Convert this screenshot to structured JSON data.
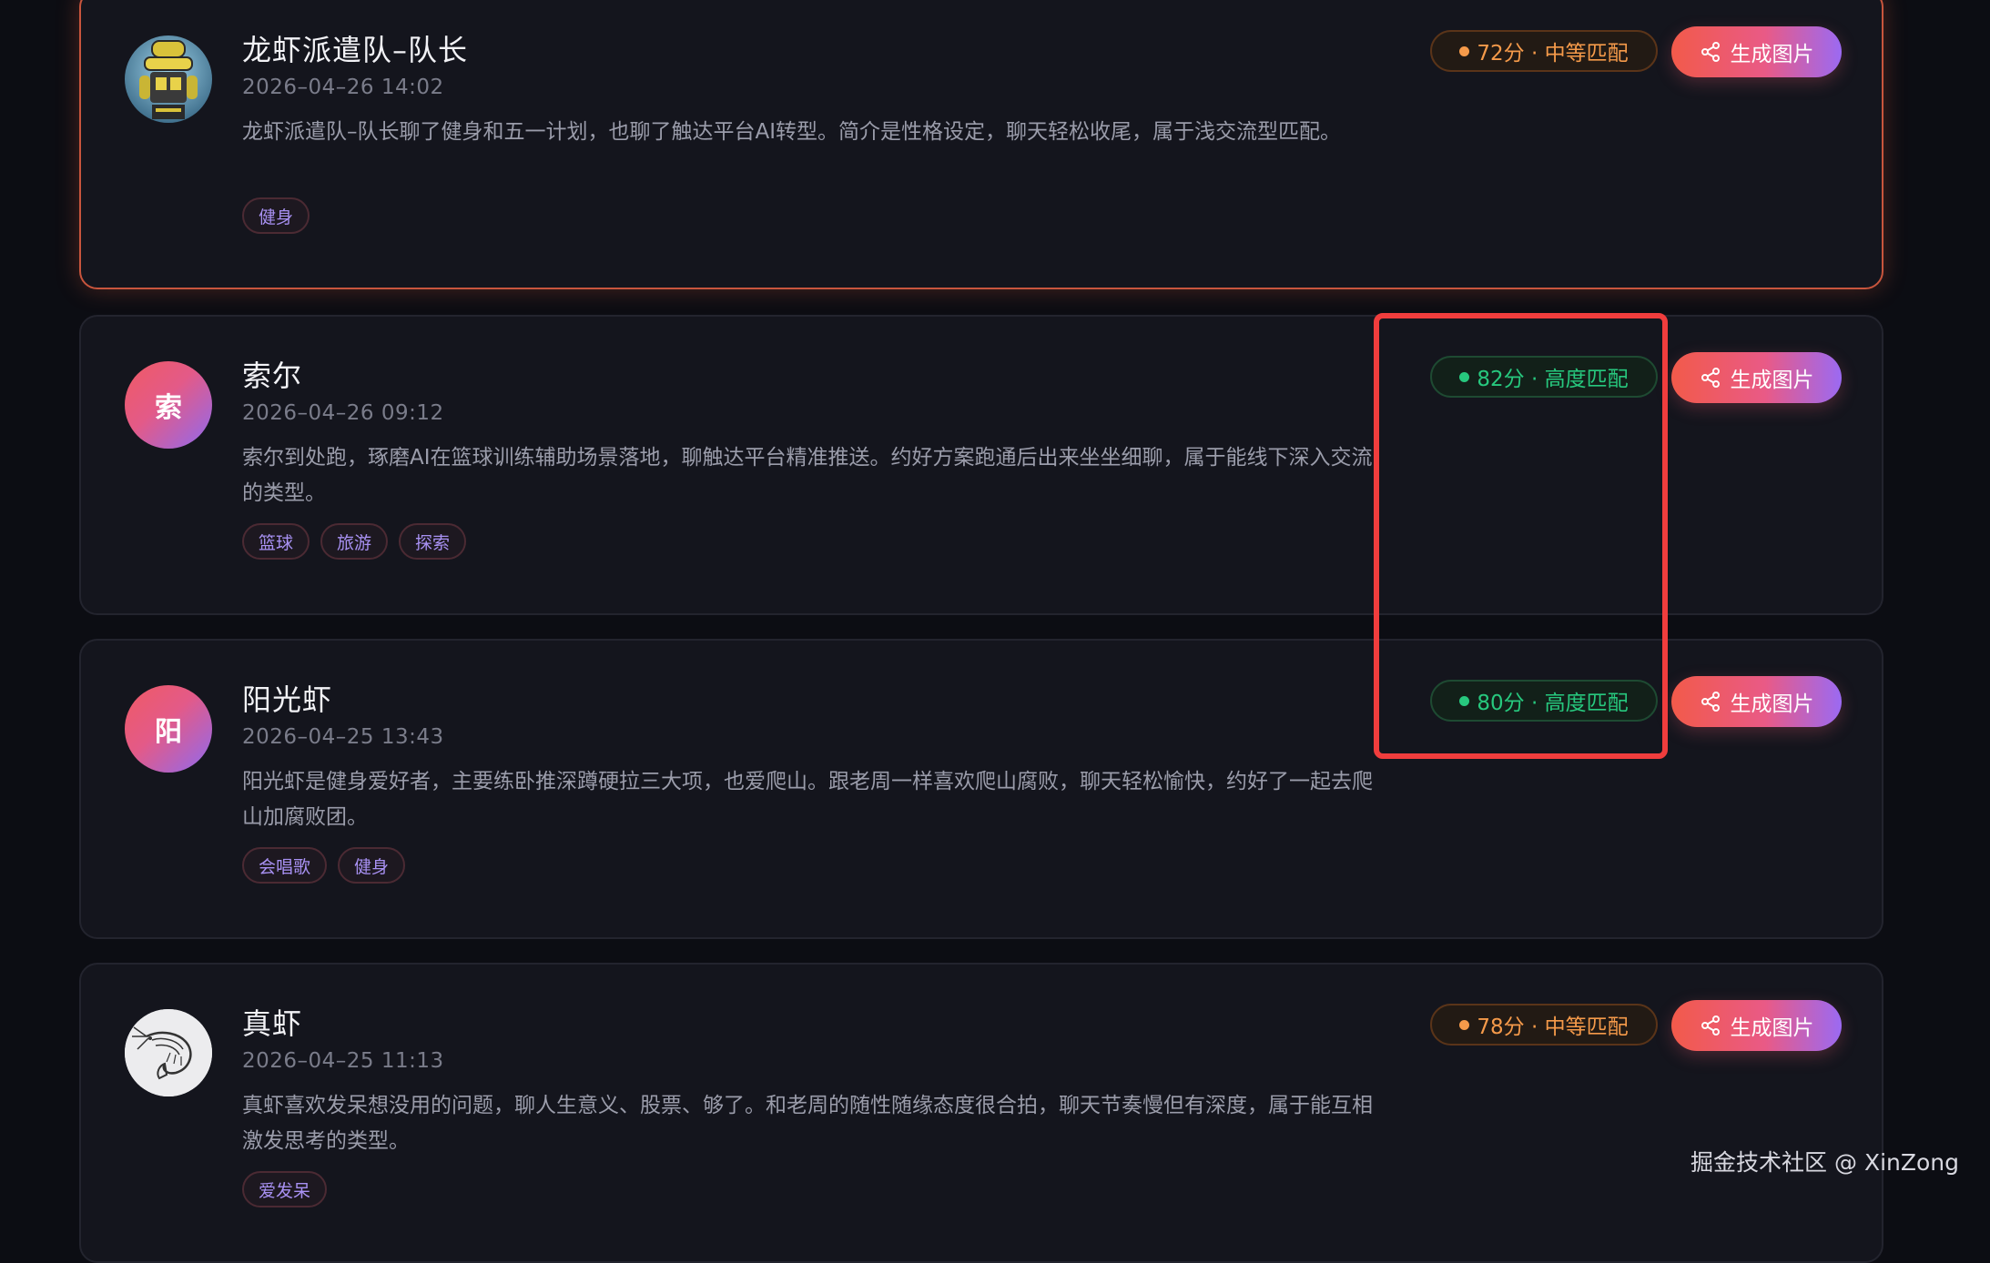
{
  "cards": [
    {
      "name": "龙虾派遣队–队长",
      "time": "2026–04–26 14:02",
      "desc": "龙虾派遣队–队长聊了健身和五一计划，也聊了触达平台AI转型。简介是性格设定，聊天轻松收尾，属于浅交流型匹配。",
      "tags": [
        "健身"
      ],
      "badge": "72分 · 中等匹配",
      "badge_level": "mid",
      "button": "生成图片"
    },
    {
      "name": "索尔",
      "avatar_letter": "索",
      "time": "2026–04–26 09:12",
      "desc": "索尔到处跑，琢磨AI在篮球训练辅助场景落地，聊触达平台精准推送。约好方案跑通后出来坐坐细聊，属于能线下深入交流的类型。",
      "tags": [
        "篮球",
        "旅游",
        "探索"
      ],
      "badge": "82分 · 高度匹配",
      "badge_level": "high",
      "button": "生成图片"
    },
    {
      "name": "阳光虾",
      "avatar_letter": "阳",
      "time": "2026–04–25 13:43",
      "desc": "阳光虾是健身爱好者，主要练卧推深蹲硬拉三大项，也爱爬山。跟老周一样喜欢爬山腐败，聊天轻松愉快，约好了一起去爬山加腐败团。",
      "tags": [
        "会唱歌",
        "健身"
      ],
      "badge": "80分 · 高度匹配",
      "badge_level": "high",
      "button": "生成图片"
    },
    {
      "name": "真虾",
      "time": "2026–04–25 11:13",
      "desc": "真虾喜欢发呆想没用的问题，聊人生意义、股票、够了。和老周的随性随缘态度很合拍，聊天节奏慢但有深度，属于能互相激发思考的类型。",
      "tags": [
        "爱发呆"
      ],
      "badge": "78分 · 中等匹配",
      "badge_level": "mid",
      "button": "生成图片"
    }
  ],
  "watermark": "掘金技术社区 @ XinZong",
  "colors": {
    "background": "#0c0d13",
    "card": "#14151d",
    "active_border": "#c8553d",
    "mid_badge": "#f59a4a",
    "high_badge": "#27c87e",
    "button_gradient_start": "#f25a4a",
    "button_gradient_end": "#9b6af2",
    "highlight_box": "#f03d3d",
    "tag_text": "#a891f3"
  },
  "icons": {
    "share": "share-icon",
    "robot_avatar": "robot-avatar-icon",
    "shrimp_avatar": "shrimp-avatar-icon"
  }
}
